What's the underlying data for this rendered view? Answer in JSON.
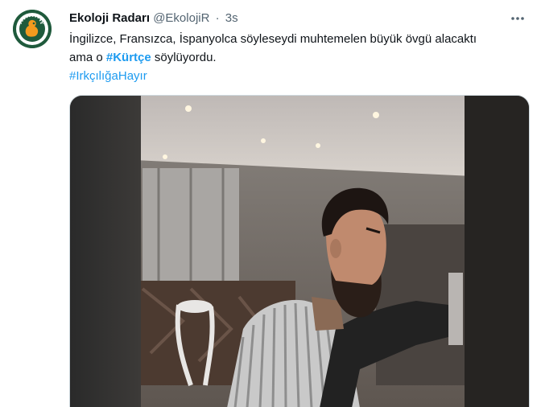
{
  "tweet": {
    "author_name": "Ekoloji Radarı",
    "handle": "@EkolojiR",
    "separator": "·",
    "time": "3s",
    "text_line1": "İngilizce, Fransızca, İspanyolca söyleseydi muhtemelen büyük övgü alacaktı",
    "text_line2_prefix": "ama o ",
    "hashtag_bold": "#Kürtçe",
    "text_line2_suffix": " söylüyordu.",
    "hashtag2": "#IrkçılığaHayır",
    "avatar_text": "EKOLOJİ RADARI",
    "more_icon": "more-icon"
  },
  "media": {
    "type": "video",
    "description_icon": "video-frame"
  },
  "colors": {
    "link": "#1d9bf0",
    "secondary_text": "#536471",
    "text": "#0f1419",
    "avatar_bg": "#1f5a3c",
    "avatar_mascot": "#f39a1e"
  }
}
